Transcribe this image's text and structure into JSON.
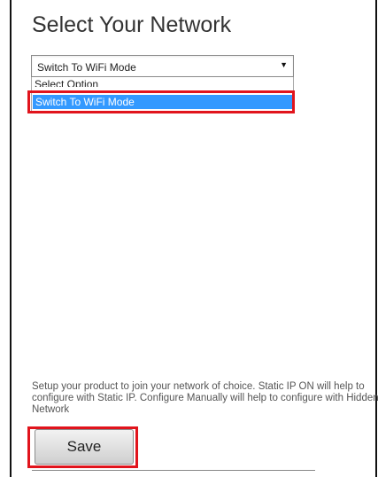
{
  "page": {
    "title": "Select Your Network"
  },
  "network_select": {
    "selected_value": "Switch To WiFi Mode",
    "options": [
      {
        "label": "Select Option"
      },
      {
        "label": "Switch To WiFi Mode"
      }
    ]
  },
  "help": {
    "text": "Setup your product to join your network of choice. Static IP ON will help to configure with Static IP. Configure Manually will help to configure with Hidden Network"
  },
  "actions": {
    "save_label": "Save"
  },
  "colors": {
    "highlight_border": "#e1141c",
    "selected_option_bg": "#3399ff"
  }
}
